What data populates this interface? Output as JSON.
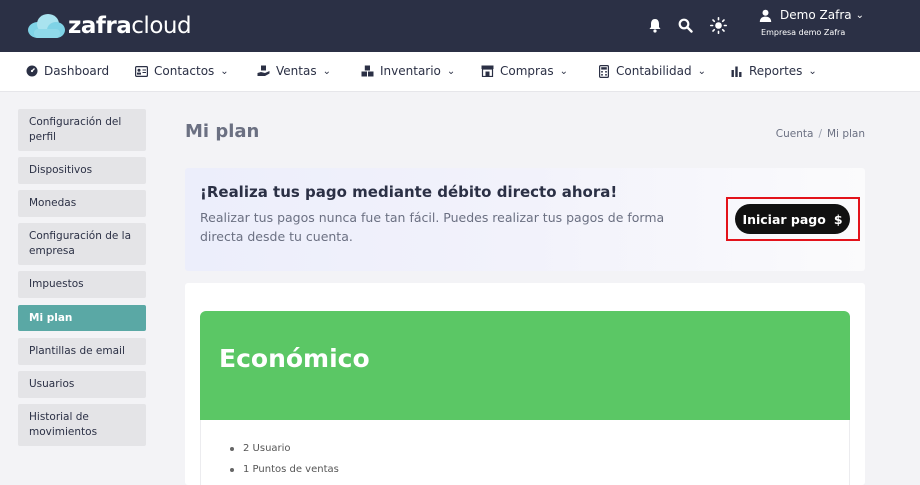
{
  "brand": {
    "bold": "zafra",
    "light": "cloud"
  },
  "header": {
    "user_name": "Demo Zafra",
    "company": "Empresa demo Zafra"
  },
  "nav": {
    "items": [
      {
        "label": "Dashboard",
        "icon": "dashboard-icon"
      },
      {
        "label": "Contactos",
        "icon": "contacts-icon"
      },
      {
        "label": "Ventas",
        "icon": "sales-icon"
      },
      {
        "label": "Inventario",
        "icon": "inventory-icon"
      },
      {
        "label": "Compras",
        "icon": "store-icon"
      },
      {
        "label": "Contabilidad",
        "icon": "calculator-icon"
      },
      {
        "label": "Reportes",
        "icon": "bar-chart-icon"
      }
    ]
  },
  "sidebar": {
    "items": [
      {
        "label": "Configuración del perfil"
      },
      {
        "label": "Dispositivos"
      },
      {
        "label": "Monedas"
      },
      {
        "label": "Configuración de la empresa"
      },
      {
        "label": "Impuestos"
      },
      {
        "label": "Mi plan"
      },
      {
        "label": "Plantillas de email"
      },
      {
        "label": "Usuarios"
      },
      {
        "label": "Historial de movimientos"
      }
    ]
  },
  "page": {
    "title": "Mi plan",
    "breadcrumb": [
      "Cuenta",
      "Mi plan"
    ]
  },
  "banner": {
    "title": "¡Realiza tus pago mediante débito directo ahora!",
    "text": "Realizar tus pagos nunca fue tan fácil. Puedes realizar tus pagos de forma directa desde tu cuenta.",
    "button_label": "Iniciar pago",
    "button_symbol": "$"
  },
  "plan": {
    "name": "Económico",
    "features": [
      "2 Usuario",
      "1 Puntos de ventas"
    ]
  },
  "colors": {
    "topbar": "#2b3045",
    "active_sidebar": "#5aa8a5",
    "plan_header": "#5bc765",
    "highlight": "#e3131b"
  }
}
